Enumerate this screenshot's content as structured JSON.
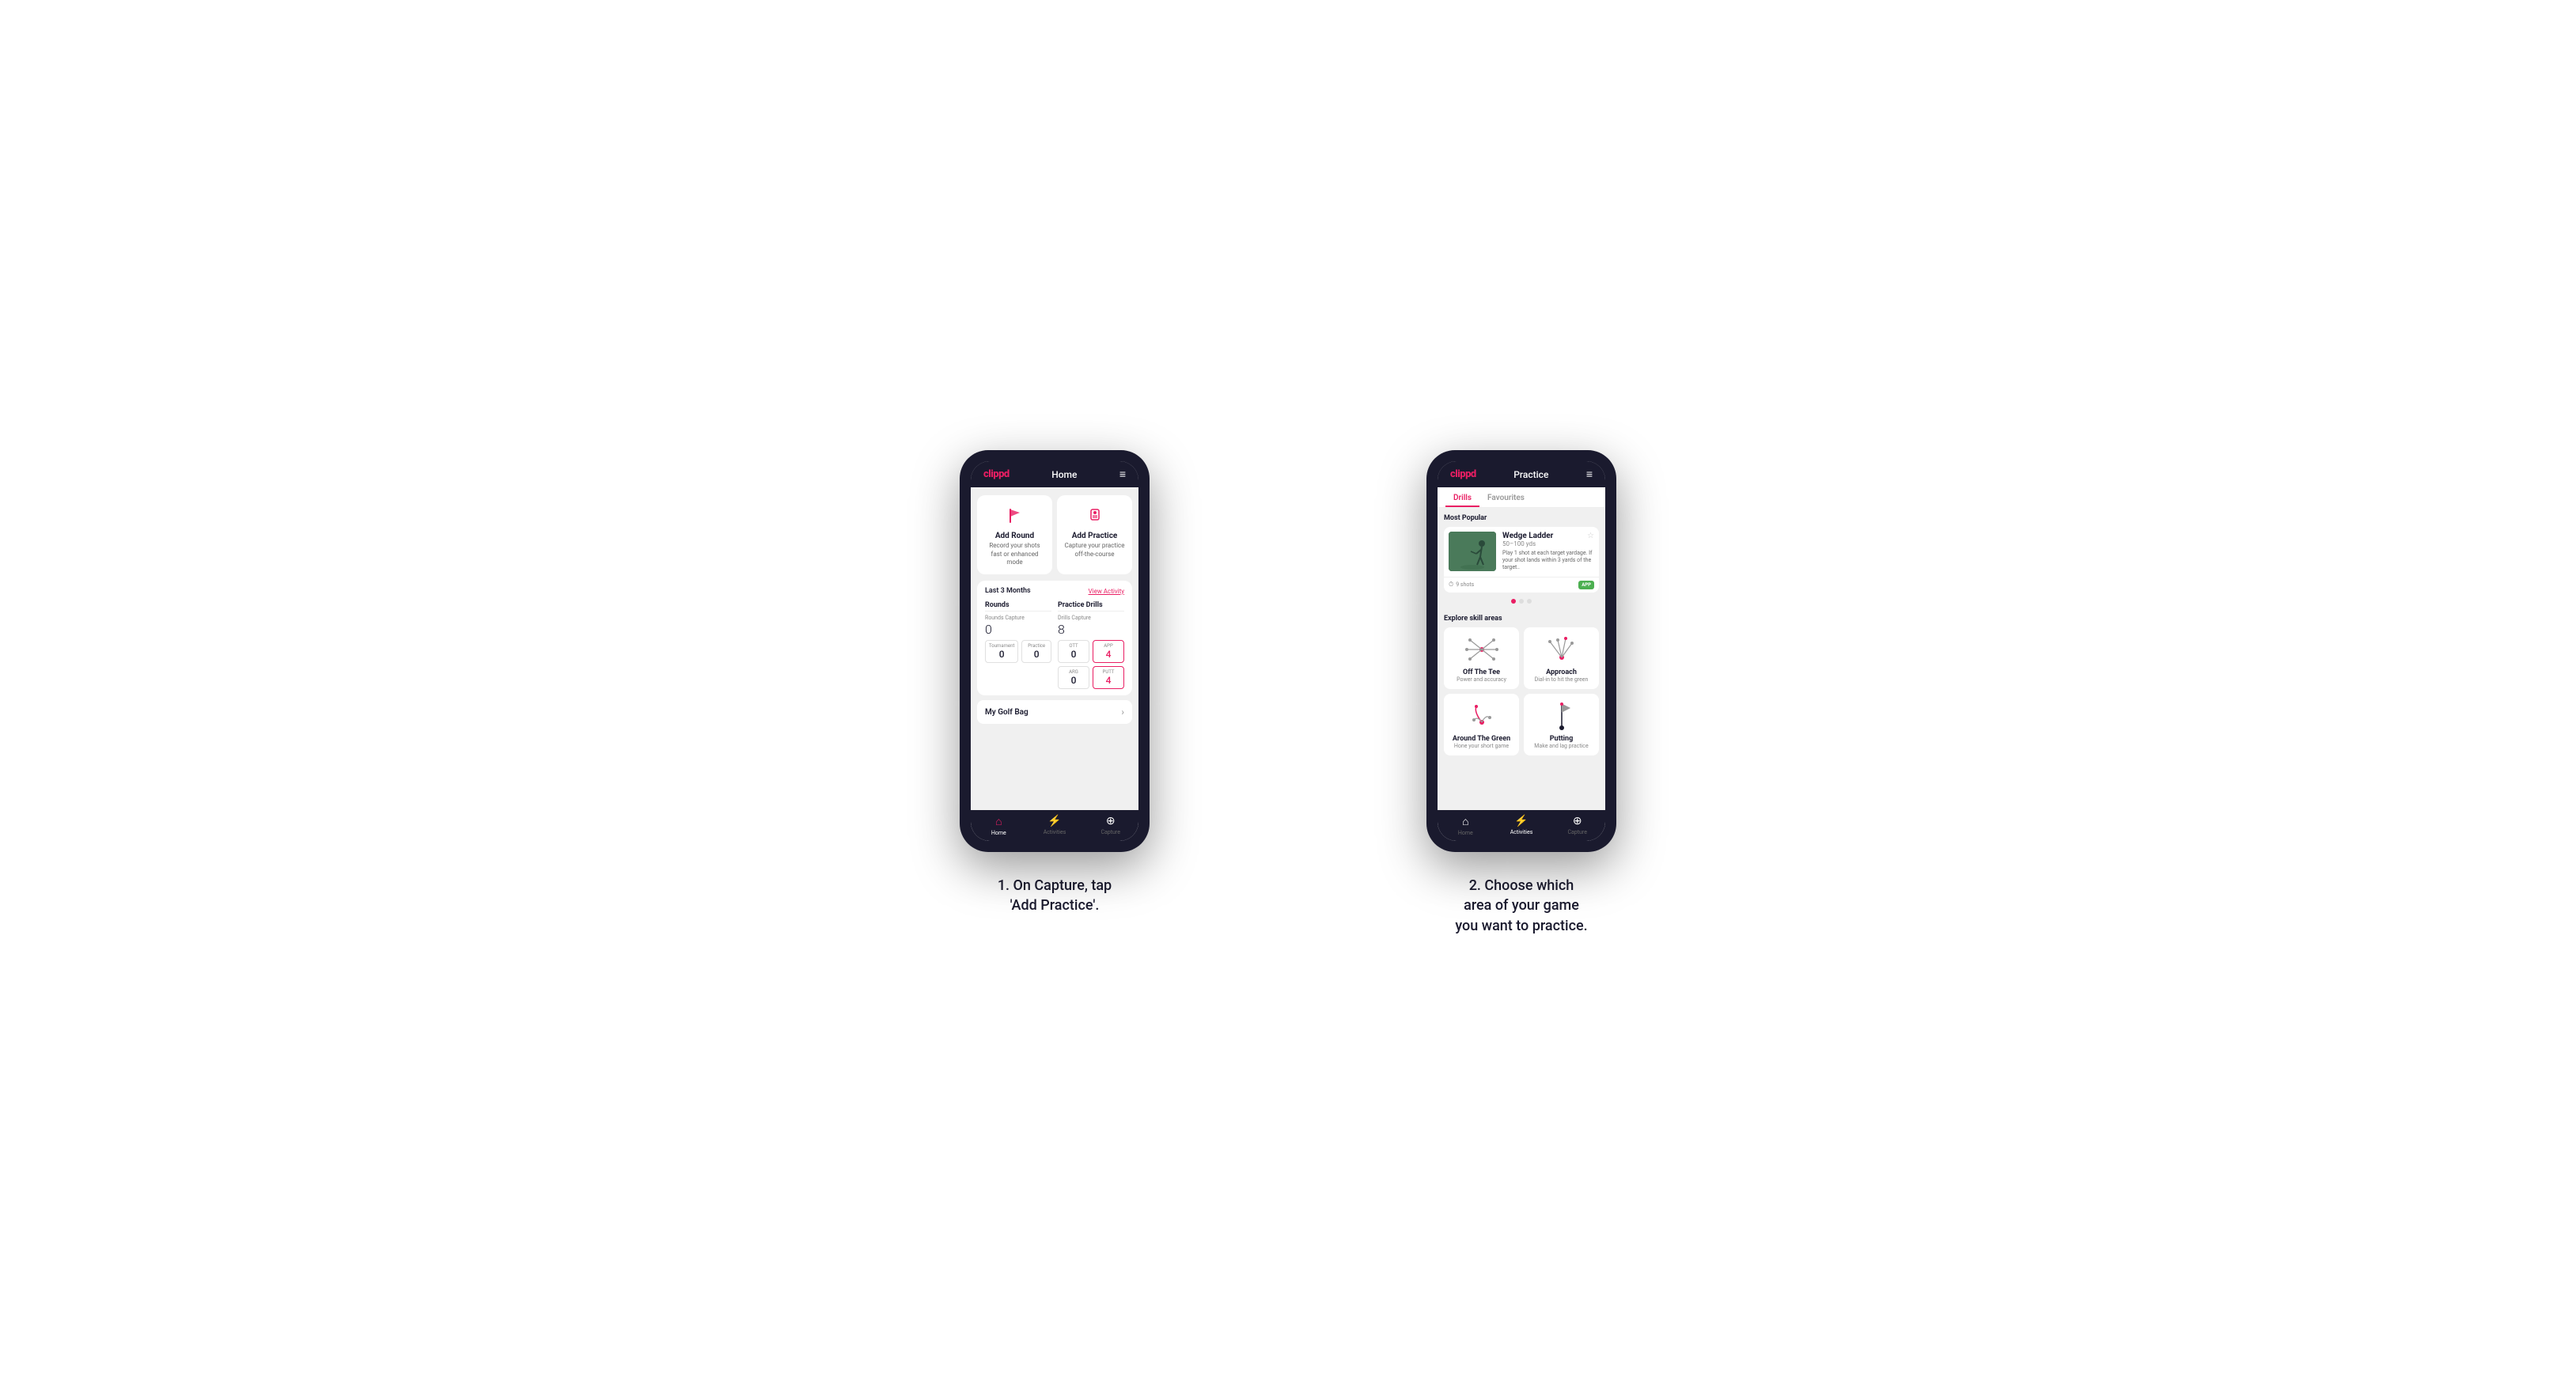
{
  "phone1": {
    "header": {
      "logo": "clippd",
      "title": "Home",
      "menu_icon": "≡"
    },
    "cards": [
      {
        "id": "add-round",
        "title": "Add Round",
        "subtitle": "Record your shots fast or enhanced mode",
        "icon": "flag"
      },
      {
        "id": "add-practice",
        "title": "Add Practice",
        "subtitle": "Capture your practice off-the-course",
        "icon": "practice"
      }
    ],
    "stats": {
      "period": "Last 3 Months",
      "view_activity": "View Activity",
      "rounds": {
        "title": "Rounds",
        "capture_label": "Rounds Capture",
        "capture_value": "0",
        "tournament_label": "Tournament",
        "tournament_value": "0",
        "practice_label": "Practice",
        "practice_value": "0"
      },
      "practice_drills": {
        "title": "Practice Drills",
        "capture_label": "Drills Capture",
        "capture_value": "8",
        "ott_label": "OTT",
        "ott_value": "0",
        "app_label": "APP",
        "app_value": "4",
        "arg_label": "ARG",
        "arg_value": "0",
        "putt_label": "PUTT",
        "putt_value": "4"
      }
    },
    "golf_bag": {
      "label": "My Golf Bag"
    },
    "bottom_nav": [
      {
        "label": "Home",
        "icon": "⌂",
        "active": true
      },
      {
        "label": "Activities",
        "icon": "⚡",
        "active": false
      },
      {
        "label": "Capture",
        "icon": "⊕",
        "active": false
      }
    ]
  },
  "phone2": {
    "header": {
      "logo": "clippd",
      "title": "Practice",
      "menu_icon": "≡"
    },
    "tabs": [
      {
        "label": "Drills",
        "active": true
      },
      {
        "label": "Favourites",
        "active": false
      }
    ],
    "most_popular": {
      "title": "Most Popular",
      "featured": {
        "title": "Wedge Ladder",
        "subtitle": "50–100 yds",
        "description": "Play 1 shot at each target yardage. If your shot lands within 3 yards of the target..",
        "shots": "9 shots",
        "badge": "APP"
      },
      "dots": [
        true,
        false,
        false
      ]
    },
    "skill_areas": {
      "title": "Explore skill areas",
      "items": [
        {
          "name": "Off The Tee",
          "desc": "Power and accuracy",
          "icon": "ott"
        },
        {
          "name": "Approach",
          "desc": "Dial-in to hit the green",
          "icon": "approach"
        },
        {
          "name": "Around The Green",
          "desc": "Hone your short game",
          "icon": "atg"
        },
        {
          "name": "Putting",
          "desc": "Make and lag practice",
          "icon": "putt"
        }
      ]
    },
    "bottom_nav": [
      {
        "label": "Home",
        "icon": "⌂",
        "active": false
      },
      {
        "label": "Activities",
        "icon": "⚡",
        "active": true
      },
      {
        "label": "Capture",
        "icon": "⊕",
        "active": false
      }
    ]
  },
  "captions": {
    "caption1": "1. On Capture, tap\n'Add Practice'.",
    "caption2": "2. Choose which\narea of your game\nyou want to practice."
  },
  "colors": {
    "brand_pink": "#e91e63",
    "phone_dark": "#1a1a2e",
    "bg_white": "#ffffff"
  }
}
